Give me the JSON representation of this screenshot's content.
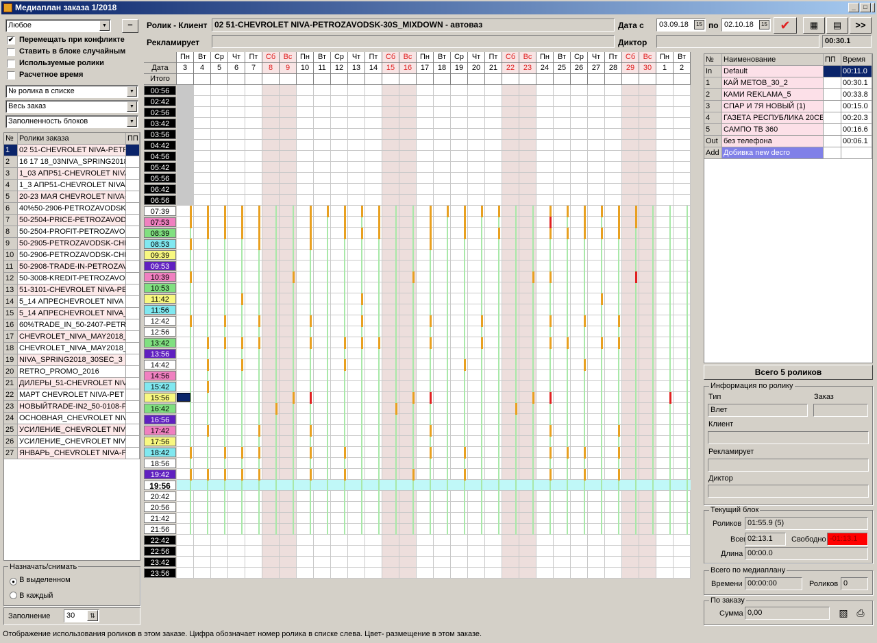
{
  "window": {
    "title": "Медиаплан заказа 1/2018",
    "min": "_",
    "max": "□",
    "close": "X"
  },
  "left": {
    "filter_combo": "Любое",
    "minus_label": "–",
    "checks": [
      {
        "label": "Перемещать при конфликте",
        "checked": "✔"
      },
      {
        "label": "Ставить в блоке случайным",
        "checked": ""
      },
      {
        "label": "Используемые ролики",
        "checked": ""
      },
      {
        "label": "Расчетное время",
        "checked": ""
      }
    ],
    "combo_sort": "№ ролика в списке",
    "combo_scope": "Весь заказ",
    "combo_fill": "Заполненность блоков",
    "list_headers": [
      "№",
      "Ролики заказа",
      "ПП"
    ],
    "spots": [
      "02 51-CHEVROLET NIVA-PETR",
      "16 17 18_03NIVA_SPRING2018",
      "1_03 АПР51-CHEVROLET NIVA",
      "1_3 АПР51-CHEVROLET NIVA",
      "20-23 МАЯ CHEVROLET NIVA-P",
      "40%50-2906-PETROZAVODSK-",
      "50-2504-PRICE-PETROZAVOD",
      "50-2504-PROFIT-PETROZAVO",
      "50-2905-PETROZAVODSK-CHE",
      "50-2906-PETROZAVODSK-CHE",
      "50-2908-TRADE-IN-PETROZAV",
      "50-3008-KREDIT-PETROZAVO",
      "51-3101-CHEVROLET NIVA-PE",
      "5_14 АПРЕCHEVROLET NIVA",
      "5_14 АПРЕCHEVROLET NIVA_",
      "60%TRADE_IN_50-2407-PETR",
      "CHEVROLET_NIVA_MAY2018_",
      "CHEVROLET_NIVA_MAY2018_",
      "NIVA_SPRING2018_30SEC_3",
      "RETRO_PROMO_2016",
      "ДИЛЕРЫ_51-CHEVROLET NIV",
      "МАРТ CHEVROLET NIVA-PET",
      "НОВЫЙTRADE-IN2_50-0108-P",
      "ОСНОВНАЯ_CHEVROLET NIV",
      "УСИЛЕНИЕ_CHEVROLET NIV",
      "УСИЛЕНИЕ_CHEVROLET NIV",
      "ЯНВАРЬ_CHEVROLET NIVA-P"
    ],
    "assign_group": "Назначать/снимать",
    "radio_sel": "В выделенном",
    "radio_each": "В каждый",
    "fill_label": "Заполнение",
    "fill_value": "30"
  },
  "header": {
    "spot_label": "Ролик - Клиент",
    "spot_value": "02 51-CHEVROLET NIVA-PETROZAVODSK-30S_MIXDOWN - автоваз",
    "adv_label": "Рекламирует",
    "adv_value": "",
    "date_from_label": "Дата с",
    "date_from": "03.09.18",
    "date_to_label": "по",
    "date_to": "02.10.18",
    "cal_icon": "15",
    "announcer_label": "Диктор",
    "announcer_value": "",
    "duration": "00:30.1",
    "more": ">>"
  },
  "grid": {
    "corner_top": "",
    "corner_date": "Дата",
    "total_label": "Итого",
    "weekdays": [
      "Пн",
      "Вт",
      "Ср",
      "Чт",
      "Пт",
      "Сб",
      "Вс",
      "Пн",
      "Вт",
      "Ср",
      "Чт",
      "Пт",
      "Сб",
      "Вс",
      "Пн",
      "Вт",
      "Ср",
      "Чт",
      "Пт",
      "Сб",
      "Вс",
      "Пн",
      "Вт",
      "Ср",
      "Чт",
      "Пт",
      "Сб",
      "Вс",
      "Пн",
      "Вт"
    ],
    "dates": [
      "3",
      "4",
      "5",
      "6",
      "7",
      "8",
      "9",
      "10",
      "11",
      "12",
      "13",
      "14",
      "15",
      "16",
      "17",
      "18",
      "19",
      "20",
      "21",
      "22",
      "23",
      "24",
      "25",
      "26",
      "27",
      "28",
      "29",
      "30",
      "1",
      "2"
    ],
    "times": [
      "00:56",
      "02:42",
      "02:56",
      "03:42",
      "03:56",
      "04:42",
      "04:56",
      "05:42",
      "05:56",
      "06:42",
      "06:56",
      "07:39",
      "07:53",
      "08:39",
      "08:53",
      "09:39",
      "09:53",
      "10:39",
      "10:53",
      "11:42",
      "11:56",
      "12:42",
      "12:56",
      "13:42",
      "13:56",
      "14:42",
      "14:56",
      "15:42",
      "15:56",
      "16:42",
      "16:56",
      "17:42",
      "17:56",
      "18:42",
      "18:56",
      "19:42",
      "19:56",
      "20:42",
      "20:56",
      "21:42",
      "21:56",
      "22:42",
      "22:56",
      "23:42",
      "23:56"
    ],
    "time_colors": [
      "#000000",
      "#000000",
      "#000000",
      "#000000",
      "#000000",
      "#000000",
      "#000000",
      "#000000",
      "#000000",
      "#000000",
      "#000000",
      "#ffffff",
      "#f080c0",
      "#80e080",
      "#80e8f0",
      "#f8f880",
      "#6020c0",
      "#f080c0",
      "#80e080",
      "#f8f880",
      "#80e8f0",
      "#ffffff",
      "#ffffff",
      "#80e080",
      "#6020c0",
      "#ffffff",
      "#f080c0",
      "#80e8f0",
      "#f8f880",
      "#80e080",
      "#6020c0",
      "#f080c0",
      "#f8f880",
      "#80e8f0",
      "#ffffff",
      "#6020c0",
      "#ffffff",
      "#ffffff",
      "#ffffff",
      "#ffffff",
      "#ffffff",
      "#000000",
      "#000000",
      "#000000",
      "#000000"
    ]
  },
  "right": {
    "headers": [
      "№",
      "Наименование",
      "ПП",
      "Время"
    ],
    "block_rows": [
      {
        "n": "In",
        "name": "Default",
        "pp": "",
        "time": "00:11.0"
      },
      {
        "n": "1",
        "name": "КАЙ МЕТОВ_30_2",
        "pp": "",
        "time": "00:30.1"
      },
      {
        "n": "2",
        "name": "КАМИ REKLAMA_5",
        "pp": "",
        "time": "00:33.8"
      },
      {
        "n": "3",
        "name": "СПАР И 7Я НОВЫЙ (1)",
        "pp": "",
        "time": "00:15.0"
      },
      {
        "n": "4",
        "name": "ГАЗЕТА РЕСПУБЛИКА 20СЕ",
        "pp": "",
        "time": "00:20.3"
      },
      {
        "n": "5",
        "name": "САМПО ТВ 360",
        "pp": "",
        "time": "00:16.6"
      },
      {
        "n": "Out",
        "name": "без телефона",
        "pp": "",
        "time": "00:06.1"
      },
      {
        "n": "Add",
        "name": "Добивка new decro",
        "pp": "",
        "time": ""
      }
    ],
    "total_spots": "Всего 5 роликов",
    "info_group": "Информация по ролику",
    "type_label": "Тип",
    "type_value": "Влет",
    "order_label": "Заказ",
    "client_label": "Клиент",
    "adv_label": "Рекламирует",
    "announcer_label": "Диктор",
    "block_group": "Текущий блок",
    "spots_label": "Роликов",
    "spots_value": "01:55.9 (5)",
    "total_label": "Всего",
    "total_value": "02:13.1",
    "free_label": "Свободно",
    "free_value": "-01:13.1",
    "length_label": "Длина",
    "length_value": "00:00.0",
    "mp_group": "Всего по медиаплану",
    "time_label": "Времени",
    "time_value": "00:00:00",
    "rolls_label": "Роликов",
    "rolls_value": "0",
    "order_group": "По заказу",
    "sum_label": "Сумма",
    "sum_value": "0,00"
  },
  "status": "Отображение использования роликов в этом заказе. Цифра обозначает номер ролика в списке слева. Цвет- размещение в этом заказе.",
  "colors": {
    "accent": "#0a246a",
    "weekend": "#f8e4e4",
    "marker": "#e8a020",
    "marker_red": "#e02020",
    "now_row": "#c0f8f8"
  }
}
